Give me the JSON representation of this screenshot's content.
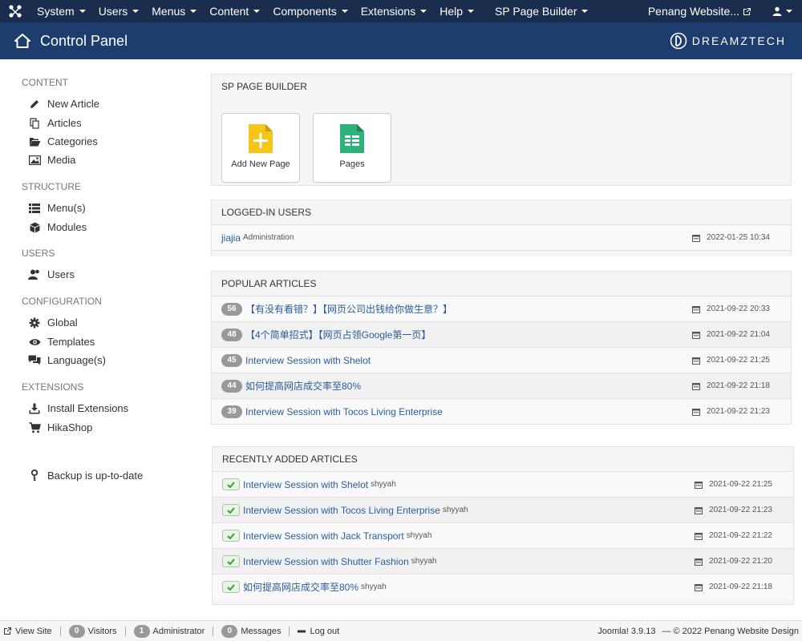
{
  "topnav": {
    "menu": [
      "System",
      "Users",
      "Menus",
      "Content",
      "Components",
      "Extensions",
      "Help",
      "SP Page Builder"
    ],
    "site_link": "Penang Website..."
  },
  "header": {
    "title": "Control Panel",
    "brand": "DREAMZTECH"
  },
  "sidebar": {
    "content_label": "CONTENT",
    "new_article": "New Article",
    "articles": "Articles",
    "categories": "Categories",
    "media": "Media",
    "structure_label": "STRUCTURE",
    "menus": "Menu(s)",
    "modules": "Modules",
    "users_label": "USERS",
    "users": "Users",
    "config_label": "CONFIGURATION",
    "global": "Global",
    "templates": "Templates",
    "languages": "Language(s)",
    "extensions_label": "EXTENSIONS",
    "install_extensions": "Install Extensions",
    "hikashop": "HikaShop",
    "backup": "Backup is up-to-date"
  },
  "sp_builder": {
    "heading": "SP PAGE BUILDER",
    "add_new_page": "Add New Page",
    "pages": "Pages"
  },
  "logged_in": {
    "heading": "LOGGED-IN USERS",
    "rows": [
      {
        "name": "jiajia",
        "role": "Administration",
        "date": "2022-01-25 10:34"
      }
    ]
  },
  "popular": {
    "heading": "POPULAR ARTICLES",
    "rows": [
      {
        "hits": "56",
        "title": "【有没有看错？】【网页公司出钱给你做生意？】",
        "date": "2021-09-22 20:33"
      },
      {
        "hits": "48",
        "title": "【4个简单招式】【网页占领Google第一页】",
        "date": "2021-09-22 21:04"
      },
      {
        "hits": "45",
        "title": "Interview Session with Shelot",
        "date": "2021-09-22 21:25"
      },
      {
        "hits": "44",
        "title": "如何提高网店成交率至80%",
        "date": "2021-09-22 21:18"
      },
      {
        "hits": "39",
        "title": "Interview Session with Tocos Living Enterprise",
        "date": "2021-09-22 21:23"
      }
    ]
  },
  "recent": {
    "heading": "RECENTLY ADDED ARTICLES",
    "rows": [
      {
        "title": "Interview Session with Shelot",
        "author": "shyyah",
        "date": "2021-09-22 21:25"
      },
      {
        "title": "Interview Session with Tocos Living Enterprise",
        "author": "shyyah",
        "date": "2021-09-22 21:23"
      },
      {
        "title": "Interview Session with Jack Transport",
        "author": "shyyah",
        "date": "2021-09-22 21:22"
      },
      {
        "title": "Interview Session with Shutter Fashion",
        "author": "shyyah",
        "date": "2021-09-22 21:20"
      },
      {
        "title": "如何提高网店成交率至80%",
        "author": "shyyah",
        "date": "2021-09-22 21:18"
      }
    ]
  },
  "footer": {
    "view_site": "View Site",
    "visitors_count": "0",
    "visitors": "Visitors",
    "admin_count": "1",
    "administrator": "Administrator",
    "messages_count": "0",
    "messages": "Messages",
    "logout": "Log out",
    "version": "Joomla! 3.9.13",
    "copyright": "— © 2022 Penang Website Design"
  },
  "colors": {
    "topnav_bg": "#1a2d4d",
    "header_bg": "#1c3d6e",
    "link": "#2a5d9a",
    "badge": "#999999"
  }
}
